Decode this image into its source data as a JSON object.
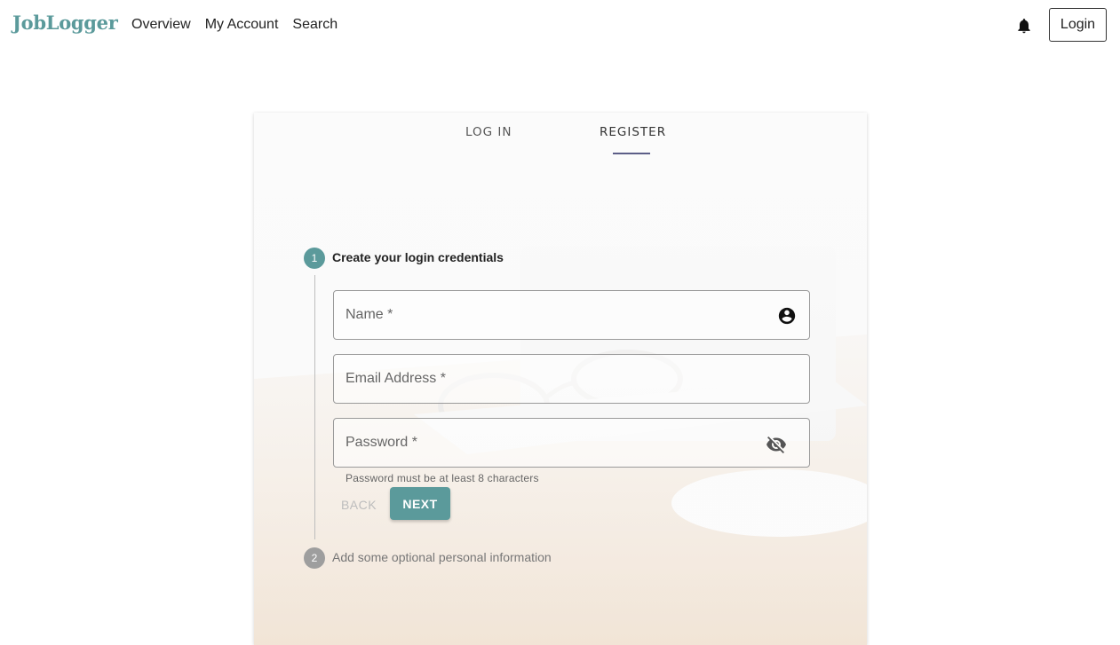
{
  "header": {
    "logo": "JobLogger",
    "nav": [
      {
        "label": "Overview"
      },
      {
        "label": "My Account"
      },
      {
        "label": "Search"
      }
    ],
    "bell_icon": "notifications-bell-icon",
    "login_label": "Login"
  },
  "tabs": {
    "login": "LOG IN",
    "register": "REGISTER",
    "active": "register"
  },
  "stepper": {
    "step1": {
      "number": "1",
      "label": "Create your login credentials"
    },
    "step2": {
      "number": "2",
      "label": "Add some optional personal information"
    }
  },
  "form": {
    "name_label": "Name *",
    "name_value": "",
    "email_label": "Email Address *",
    "email_value": "",
    "password_label": "Password *",
    "password_value": "",
    "password_helper": "Password must be at least 8 characters",
    "back_label": "BACK",
    "next_label": "NEXT"
  },
  "colors": {
    "brand": "#5b9a9b",
    "tab_indicator": "#5c5e87",
    "step_inactive": "#9e9e9e"
  }
}
